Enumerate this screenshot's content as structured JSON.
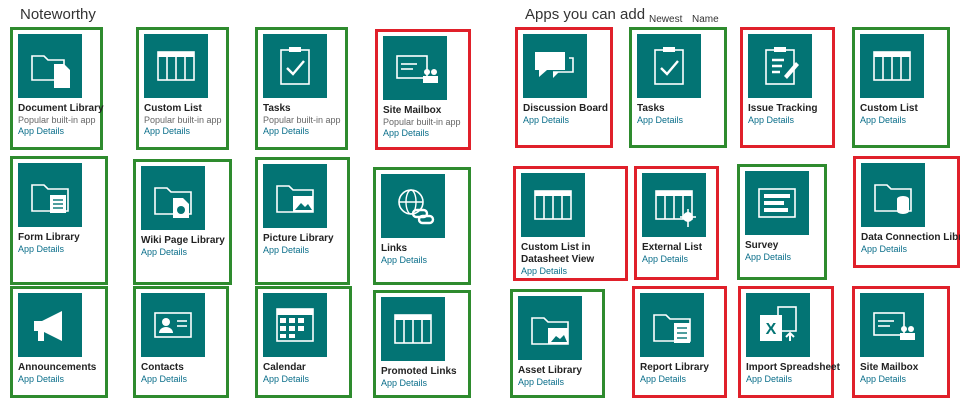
{
  "sections": {
    "noteworthy": "Noteworthy",
    "apps": "Apps you can add",
    "sort_newest": "Newest",
    "sort_name": "Name"
  },
  "tiles": [
    {
      "name": "Document Library",
      "desc": "Popular built-in app",
      "details": "App Details",
      "icon": "document-library-icon",
      "status": "green"
    },
    {
      "name": "Custom List",
      "desc": "Popular built-in app",
      "details": "App Details",
      "icon": "custom-list-icon",
      "status": "green"
    },
    {
      "name": "Tasks",
      "desc": "Popular built-in app",
      "details": "App Details",
      "icon": "tasks-icon",
      "status": "green"
    },
    {
      "name": "Site Mailbox",
      "desc": "Popular built-in app",
      "details": "App Details",
      "icon": "site-mailbox-icon",
      "status": "red"
    },
    {
      "name": "Discussion Board",
      "details": "App Details",
      "icon": "discussion-board-icon",
      "status": "red"
    },
    {
      "name": "Tasks",
      "details": "App Details",
      "icon": "tasks-icon",
      "status": "green"
    },
    {
      "name": "Issue Tracking",
      "details": "App Details",
      "icon": "issue-tracking-icon",
      "status": "red"
    },
    {
      "name": "Custom List",
      "details": "App Details",
      "icon": "custom-list-icon",
      "status": "green"
    },
    {
      "name": "Form Library",
      "details": "App Details",
      "icon": "form-library-icon",
      "status": "green"
    },
    {
      "name": "Wiki Page Library",
      "details": "App Details",
      "icon": "wiki-page-library-icon",
      "status": "green"
    },
    {
      "name": "Picture Library",
      "details": "App Details",
      "icon": "picture-library-icon",
      "status": "green"
    },
    {
      "name": "Links",
      "details": "App Details",
      "icon": "links-icon",
      "status": "green"
    },
    {
      "name": "Custom List in Datasheet View",
      "details": "App Details",
      "icon": "datasheet-icon",
      "status": "red"
    },
    {
      "name": "External List",
      "details": "App Details",
      "icon": "external-list-icon",
      "status": "red"
    },
    {
      "name": "Survey",
      "details": "App Details",
      "icon": "survey-icon",
      "status": "green"
    },
    {
      "name": "Data Connection Library",
      "details": "App Details",
      "icon": "data-connection-library-icon",
      "status": "red"
    },
    {
      "name": "Announcements",
      "details": "App Details",
      "icon": "announcements-icon",
      "status": "green"
    },
    {
      "name": "Contacts",
      "details": "App Details",
      "icon": "contacts-icon",
      "status": "green"
    },
    {
      "name": "Calendar",
      "details": "App Details",
      "icon": "calendar-icon",
      "status": "green"
    },
    {
      "name": "Promoted Links",
      "details": "App Details",
      "icon": "promoted-links-icon",
      "status": "green"
    },
    {
      "name": "Asset Library",
      "details": "App Details",
      "icon": "asset-library-icon",
      "status": "green"
    },
    {
      "name": "Report Library",
      "details": "App Details",
      "icon": "report-library-icon",
      "status": "red"
    },
    {
      "name": "Import Spreadsheet",
      "details": "App Details",
      "icon": "import-spreadsheet-icon",
      "status": "red"
    },
    {
      "name": "Site Mailbox",
      "details": "App Details",
      "icon": "site-mailbox-icon",
      "status": "red"
    }
  ],
  "colors": {
    "tile_icon": "#037474",
    "green_border": "#2e8b2e",
    "red_border": "#e0202a",
    "link": "#0a6e8a"
  }
}
